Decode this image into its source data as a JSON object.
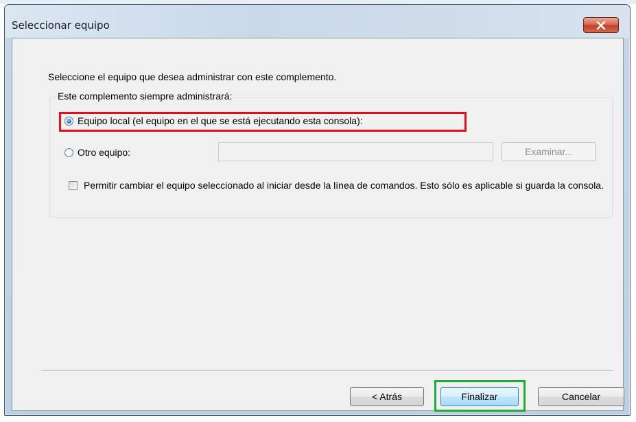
{
  "window": {
    "title": "Seleccionar equipo"
  },
  "dialog": {
    "instruction": "Seleccione el equipo que desea administrar con este complemento.",
    "group_label": "Este complemento siempre administrará:",
    "option_local": "Equipo local (el equipo en el que se está ejecutando esta consola):",
    "option_other": "Otro equipo:",
    "other_computer_value": "",
    "browse_label": "Examinar...",
    "allow_change_label": "Permitir cambiar el equipo seleccionado al iniciar desde la línea de comandos. Esto sólo es aplicable si guarda la consola.",
    "selected_option": "local",
    "allow_change_checked": false
  },
  "buttons": {
    "back": "< Atrás",
    "finish": "Finalizar",
    "cancel": "Cancelar"
  },
  "colors": {
    "highlight_local": "#e3101b",
    "highlight_finish": "#1fac38",
    "close_button": "#c1432a"
  },
  "icons": {
    "close": "close-icon"
  }
}
